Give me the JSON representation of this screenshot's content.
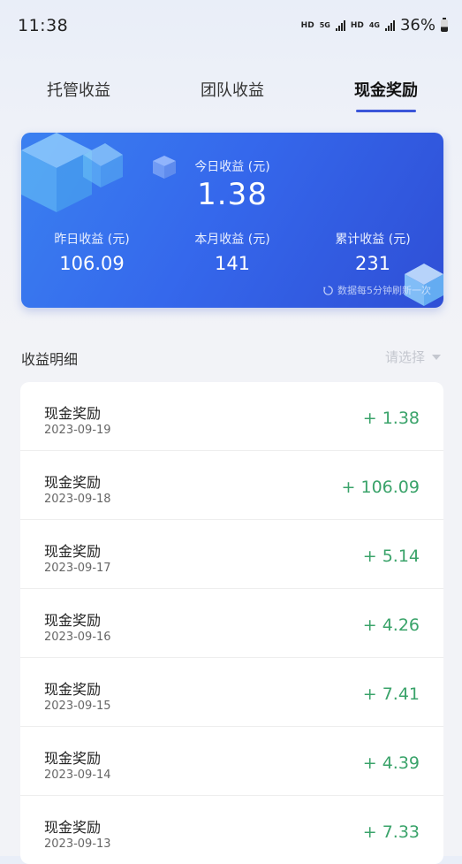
{
  "status_bar": {
    "time": "11:38",
    "hd1": "HD",
    "net1": "5G",
    "hd2": "HD",
    "net2": "4G",
    "battery": "36%"
  },
  "tabs": [
    {
      "label": "托管收益",
      "active": false
    },
    {
      "label": "团队收益",
      "active": false
    },
    {
      "label": "现金奖励",
      "active": true
    }
  ],
  "summary": {
    "today_label": "今日收益 (元)",
    "today_value": "1.38",
    "yesterday_label": "昨日收益 (元)",
    "yesterday_value": "106.09",
    "month_label": "本月收益 (元)",
    "month_value": "141",
    "total_label": "累计收益 (元)",
    "total_value": "231",
    "refresh_note": "数据每5分钟刷新一次"
  },
  "detail": {
    "title": "收益明细",
    "select_placeholder": "请选择"
  },
  "records": [
    {
      "title": "现金奖励",
      "date": "2023-09-19",
      "amount": "+ 1.38"
    },
    {
      "title": "现金奖励",
      "date": "2023-09-18",
      "amount": "+ 106.09"
    },
    {
      "title": "现金奖励",
      "date": "2023-09-17",
      "amount": "+ 5.14"
    },
    {
      "title": "现金奖励",
      "date": "2023-09-16",
      "amount": "+ 4.26"
    },
    {
      "title": "现金奖励",
      "date": "2023-09-15",
      "amount": "+ 7.41"
    },
    {
      "title": "现金奖励",
      "date": "2023-09-14",
      "amount": "+ 4.39"
    },
    {
      "title": "现金奖励",
      "date": "2023-09-13",
      "amount": "+ 7.33"
    }
  ],
  "colors": {
    "accent": "#3b56d9",
    "positive": "#3aa36a",
    "card_start": "#3a80f0",
    "card_end": "#2f4fd6"
  }
}
